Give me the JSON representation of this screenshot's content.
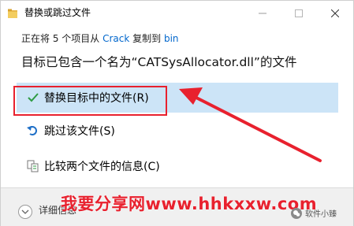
{
  "window": {
    "title": "替换或跳过文件"
  },
  "progress": {
    "prefix": "正在将 5 个项目从 ",
    "source": "Crack",
    "middle": " 复制到 ",
    "destination": "bin"
  },
  "heading": "目标已包含一个名为“CATSysAllocator.dll”的文件",
  "options": {
    "replace_label": "替换目标中的文件(R)",
    "skip_label": "跳过该文件(S)",
    "compare_label": "比较两个文件的信息(C)"
  },
  "footer": {
    "details_label": "详细信息"
  },
  "watermark": "我要分享网www.hhkxxw.com",
  "brand": "软件小臻",
  "colors": {
    "accent": "#0066cc",
    "selection": "#cce4f7",
    "check": "#2e9b43",
    "annotation_red": "#e8212e"
  }
}
